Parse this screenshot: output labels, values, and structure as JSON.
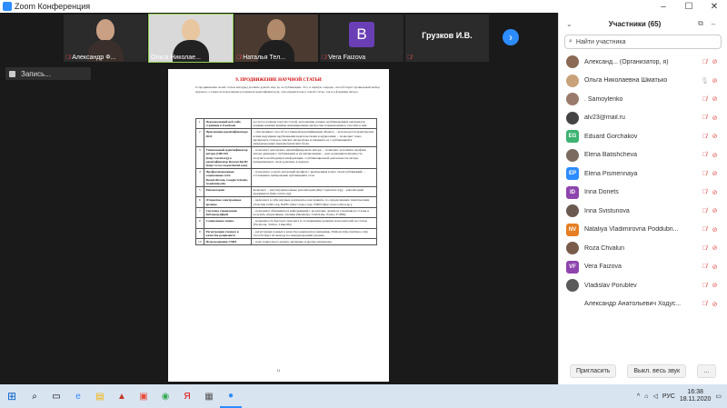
{
  "window": {
    "title": "Zoom Конференция"
  },
  "video_strip": {
    "tiles": [
      {
        "name": "Александр Ф...",
        "muted": true,
        "style": "man"
      },
      {
        "name": "Ольга Николае...",
        "muted": false,
        "active": true,
        "style": "blonde"
      },
      {
        "name": "Наталья Тел...",
        "muted": true,
        "style": "woman"
      },
      {
        "name": "Vera Faizova",
        "muted": true,
        "letter": "B"
      },
      {
        "name": "Грузков И.В.",
        "muted": true,
        "centered": true
      }
    ],
    "next_icon": "chevron-right-icon"
  },
  "recording": {
    "label": "Запись..."
  },
  "document": {
    "heading": "9. ПРОДВИЖЕНИЕ НАУЧНОЙ СТАТЬИ",
    "intro": "О продвижении своей статьи автор(ы) должны думать еще до ее публикации. Это, в первую очередь, способствует правильный выбор журнала, а также использование различных идентификаторов, относящихся как к самой статье, так и к фамилии автора.",
    "rows": [
      {
        "n": "1",
        "title": "Персональный веб-сайт, страница в Facebook",
        "desc": "доступ к полным текстам статей, дополнение разных опубликованных материалов новыми комментариями, инициирование дискуссии и привлечение к участию в них."
      },
      {
        "n": "2",
        "title": "Присвоение идентификатора DOI",
        "desc": "– обеспечивает способ постоянной идентификации объекта, – используется практически всеми ведущими зарубежными издательствами и журналами; – позволяет точно цитировать статью в списках литературы и связывать ее с публикацией в международных наукометрических базах."
      },
      {
        "n": "3",
        "title": "Уникальный идентификатор автора (ORCID (http://orcid.org) и идентификатор ResearcherID (http://www.researcherid.com)",
        "desc": "– позволяет однозначно идентифицировать автора; – позволяет дополнить профиль автора данными о публикациях и их цитировании; – дает редакции возможность получить необходимую информацию о публикационной деятельности автора, направляющего свою рукопись в журнал."
      },
      {
        "n": "4",
        "title": "Профессиональные социальные сети ResearchGate, Google Scholar, Academia.edu",
        "desc": "– позволяют создать авторский профиль с включением в него своих публикаций; – отслеживать цитирование публикаций в сети"
      },
      {
        "n": "5",
        "title": "Репозитории",
        "desc": "включает: – институциональные репозитории (http://opendoar.org); – репозиторий препринтов (http://arxiv.org)."
      },
      {
        "n": "6",
        "title": "Открытые электронные архивы",
        "desc": "– включают в себя научные документы, как правило, по определенным тематическим областям (arXiv.org, RePEc (http://repec.org), SSRN (http://ssrn.com) и др.)."
      },
      {
        "n": "7",
        "title": "Системы управления библиографией",
        "desc": "– позволяют обмениваться информацией с коллегами, делиться ссылками на статьи и получать оперативные отклики (Mendeley, CiteULike, Zotero, F1000)."
      },
      {
        "n": "8",
        "title": "Социальные медиа",
        "desc": "– возможность быстрого контакта и отслеживания реакции пользователей на статьи (Facebook, Twitter, LinkedIn)"
      },
      {
        "n": "9",
        "title": "Регистрация ученого в качестве рецензента",
        "desc": "– регистрация ученых в качестве рецензентов (например, Publons http://publons.com) способствует их выходу на международный уровень."
      },
      {
        "n": "10",
        "title": "Использование СМИ",
        "desc": "– подготовка пресс-релиза, интервью и другие материалы."
      }
    ],
    "page_number": "11"
  },
  "participants": {
    "title": "Участники (65)",
    "search_placeholder": "Найти участника",
    "list": [
      {
        "name": "Александ... (Организатор, я)",
        "avatar_color": "#8a6a55",
        "photo": true,
        "video_off": true
      },
      {
        "name": "Ольга Николаевна Шматько",
        "avatar_color": "#c9a27a",
        "photo": true,
        "mic_on": true,
        "video_off": true
      },
      {
        "name": ". Samoylenko",
        "avatar_color": "#9a7a6a",
        "photo": true,
        "video_off": true
      },
      {
        "name": "alv23@mail.ru",
        "avatar_color": "#444444",
        "photo": true,
        "video_off": true
      },
      {
        "name": "Eduard Gorchakov",
        "avatar_color": "#3cb371",
        "initials": "EG",
        "video_off": true
      },
      {
        "name": "Elena Batishcheva",
        "avatar_color": "#7a6a60",
        "photo": true,
        "video_off": true
      },
      {
        "name": "Elena Pismennaya",
        "avatar_color": "#2d8cff",
        "initials": "EP",
        "video_off": true
      },
      {
        "name": "Inna Donets",
        "avatar_color": "#8e44ad",
        "initials": "ID",
        "video_off": true
      },
      {
        "name": "Inna Svistunova",
        "avatar_color": "#6a5a50",
        "photo": true,
        "video_off": true
      },
      {
        "name": "Nataliya Vladimirovna Poddubn...",
        "avatar_color": "#e67e22",
        "initials": "NV",
        "video_off": true
      },
      {
        "name": "Roza Chvalun",
        "avatar_color": "#7a5a4a",
        "photo": true,
        "video_off": true
      },
      {
        "name": "Vera Faizova",
        "avatar_color": "#8e44ad",
        "initials": "VF",
        "video_off": true
      },
      {
        "name": "Vladislav Porublev",
        "avatar_color": "#5a5a5a",
        "photo": true,
        "video_off": true
      },
      {
        "name": "Александр Анатольевич Ходус...",
        "avatar_color": "#ffffff",
        "photo": false,
        "video_off": true
      }
    ],
    "invite_label": "Пригласить",
    "mute_all_label": "Выкл. весь звук"
  },
  "taskbar": {
    "lang": "РУС",
    "time": "16:38",
    "date": "18.11.2020"
  }
}
